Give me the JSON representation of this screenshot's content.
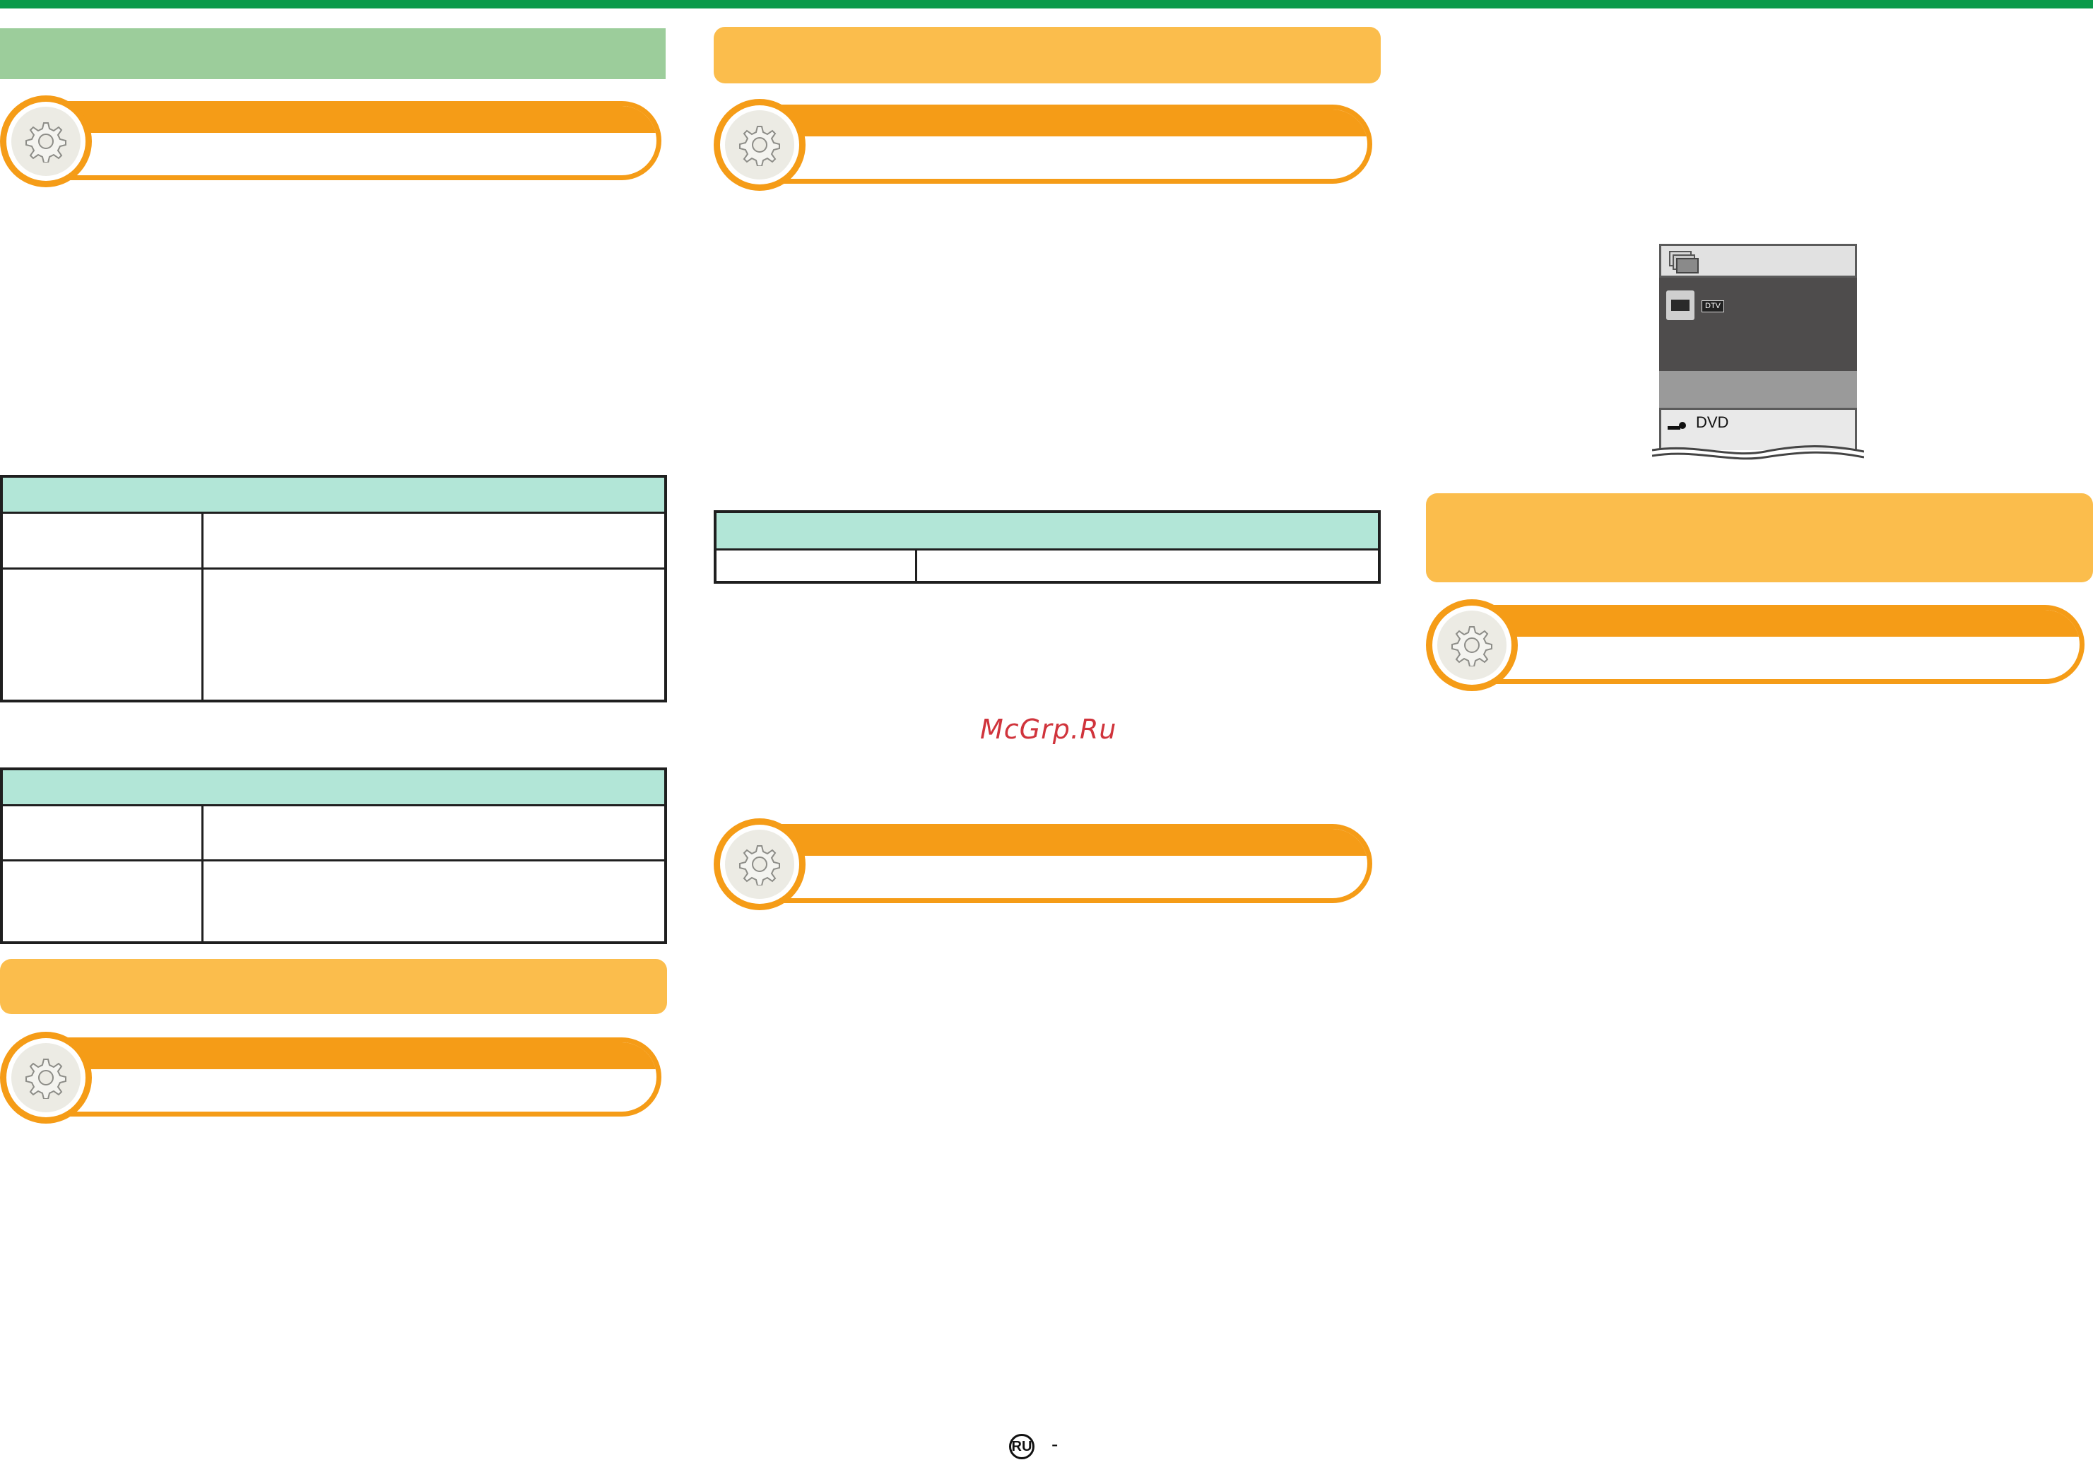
{
  "page": {
    "watermark": "McGrp.Ru",
    "footer": {
      "lang_badge": "RU",
      "separator": "-"
    }
  },
  "osd_menu": {
    "input_tag": "DTV",
    "item_label": "DVD"
  },
  "colors": {
    "top_bar": "#0b9a4a",
    "section_green": "#9ccd9b",
    "section_amber": "#fbbd4c",
    "gear_orange": "#f59c17",
    "table_header": "#b2e6d7",
    "watermark": "#d0343c"
  },
  "icons": [
    "gear-icon",
    "plug-icon",
    "input-tab-icon",
    "menu-stack-icon"
  ]
}
